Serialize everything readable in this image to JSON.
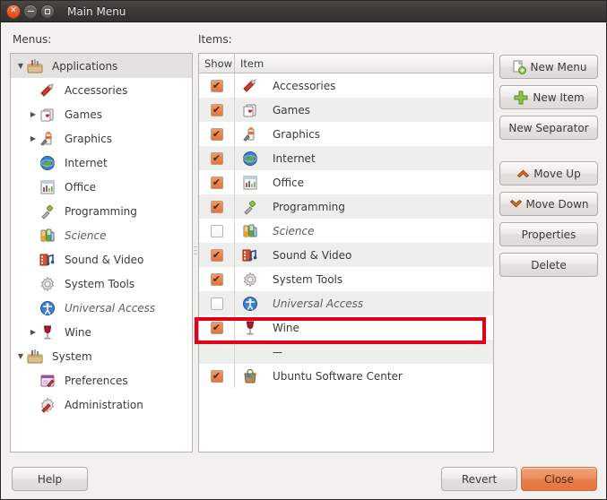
{
  "window": {
    "title": "Main Menu",
    "close_icon": "close-icon",
    "minimize_icon": "minimize-icon",
    "maximize_icon": "maximize-icon",
    "accent_orange": "#dd4814",
    "annotation_color": "#e2001a"
  },
  "labels": {
    "menus": "Menus:",
    "items": "Items:"
  },
  "tree": {
    "rows": [
      {
        "label": "Applications",
        "icon": "toolbox-icon",
        "arrow": "▼",
        "indent": 0,
        "selected": true,
        "dim": false
      },
      {
        "label": "Accessories",
        "icon": "accessories-icon",
        "arrow": "",
        "indent": 1,
        "selected": false,
        "dim": false
      },
      {
        "label": "Games",
        "icon": "games-icon",
        "arrow": "▶",
        "indent": 1,
        "selected": false,
        "dim": false
      },
      {
        "label": "Graphics",
        "icon": "graphics-icon",
        "arrow": "▶",
        "indent": 1,
        "selected": false,
        "dim": false
      },
      {
        "label": "Internet",
        "icon": "internet-globe-icon",
        "arrow": "",
        "indent": 1,
        "selected": false,
        "dim": false
      },
      {
        "label": "Office",
        "icon": "office-icon",
        "arrow": "",
        "indent": 1,
        "selected": false,
        "dim": false
      },
      {
        "label": "Programming",
        "icon": "programming-icon",
        "arrow": "",
        "indent": 1,
        "selected": false,
        "dim": false
      },
      {
        "label": "Science",
        "icon": "science-icon",
        "arrow": "",
        "indent": 1,
        "selected": false,
        "dim": true
      },
      {
        "label": "Sound & Video",
        "icon": "sound-video-icon",
        "arrow": "",
        "indent": 1,
        "selected": false,
        "dim": false
      },
      {
        "label": "System Tools",
        "icon": "system-tools-icon",
        "arrow": "",
        "indent": 1,
        "selected": false,
        "dim": false
      },
      {
        "label": "Universal Access",
        "icon": "universal-access-icon",
        "arrow": "",
        "indent": 1,
        "selected": false,
        "dim": true
      },
      {
        "label": "Wine",
        "icon": "wine-glass-icon",
        "arrow": "▶",
        "indent": 1,
        "selected": false,
        "dim": false
      },
      {
        "label": "System",
        "icon": "toolbox-icon",
        "arrow": "▼",
        "indent": 0,
        "selected": false,
        "dim": false
      },
      {
        "label": "Preferences",
        "icon": "preferences-icon",
        "arrow": "",
        "indent": 1,
        "selected": false,
        "dim": false
      },
      {
        "label": "Administration",
        "icon": "administration-icon",
        "arrow": "",
        "indent": 1,
        "selected": false,
        "dim": false
      }
    ]
  },
  "items_list": {
    "columns": {
      "show": "Show",
      "item": "Item"
    },
    "rows": [
      {
        "checked": true,
        "label": "Accessories",
        "icon": "accessories-icon",
        "dim": false,
        "separator": false,
        "highlighted": false
      },
      {
        "checked": true,
        "label": "Games",
        "icon": "games-icon",
        "dim": false,
        "separator": false,
        "highlighted": false
      },
      {
        "checked": true,
        "label": "Graphics",
        "icon": "graphics-icon",
        "dim": false,
        "separator": false,
        "highlighted": false
      },
      {
        "checked": true,
        "label": "Internet",
        "icon": "internet-globe-icon",
        "dim": false,
        "separator": false,
        "highlighted": false
      },
      {
        "checked": true,
        "label": "Office",
        "icon": "office-icon",
        "dim": false,
        "separator": false,
        "highlighted": false
      },
      {
        "checked": true,
        "label": "Programming",
        "icon": "programming-icon",
        "dim": false,
        "separator": false,
        "highlighted": false
      },
      {
        "checked": false,
        "label": "Science",
        "icon": "science-icon",
        "dim": true,
        "separator": false,
        "highlighted": false
      },
      {
        "checked": true,
        "label": "Sound & Video",
        "icon": "sound-video-icon",
        "dim": false,
        "separator": false,
        "highlighted": false
      },
      {
        "checked": true,
        "label": "System Tools",
        "icon": "system-tools-icon",
        "dim": false,
        "separator": false,
        "highlighted": false
      },
      {
        "checked": false,
        "label": "Universal Access",
        "icon": "universal-access-icon",
        "dim": true,
        "separator": false,
        "highlighted": false
      },
      {
        "checked": true,
        "label": "Wine",
        "icon": "wine-glass-icon",
        "dim": false,
        "separator": false,
        "highlighted": true
      },
      {
        "checked": null,
        "label": "---",
        "icon": "",
        "dim": false,
        "separator": true,
        "highlighted": false
      },
      {
        "checked": true,
        "label": "Ubuntu Software Center",
        "icon": "software-center-icon",
        "dim": false,
        "separator": false,
        "highlighted": false
      }
    ],
    "checkmark_glyph": "✔"
  },
  "side_buttons": [
    {
      "label": "New Menu",
      "icon": "new-menu-icon"
    },
    {
      "label": "New Item",
      "icon": "new-item-plus-icon"
    },
    {
      "label": "New Separator",
      "icon": ""
    },
    {
      "label": "Move Up",
      "icon": "chevron-up-icon"
    },
    {
      "label": "Move Down",
      "icon": "chevron-down-icon"
    },
    {
      "label": "Properties",
      "icon": ""
    },
    {
      "label": "Delete",
      "icon": ""
    }
  ],
  "bottom_buttons": {
    "help": "Help",
    "revert": "Revert",
    "close": "Close"
  }
}
